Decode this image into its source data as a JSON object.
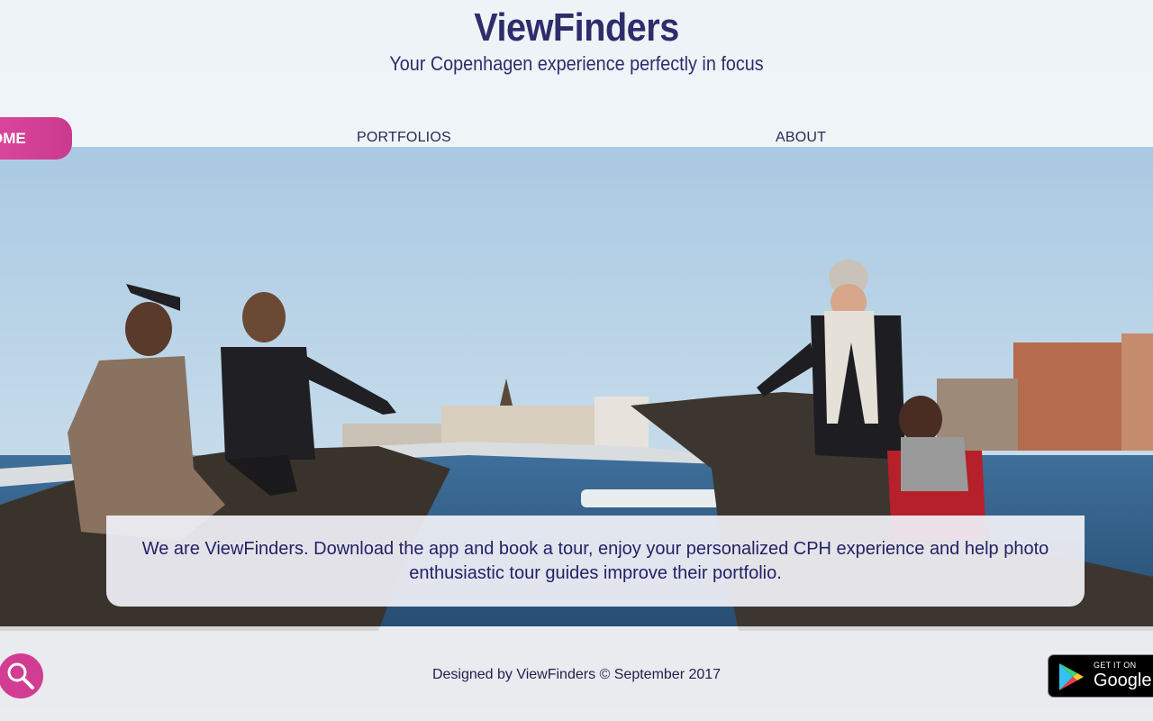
{
  "header": {
    "title": "ViewFinders",
    "tagline": "Your Copenhagen experience perfectly in focus"
  },
  "nav": {
    "home": "OME",
    "portfolios": "PORTFOLIOS",
    "about": "ABOUT"
  },
  "about": {
    "text": "We are ViewFinders. Download the app and book a tour, enjoy your personalized CPH experience and help photo enthusiastic tour guides improve their portfolio."
  },
  "footer": {
    "credit": "Designed by ViewFinders © September 2017"
  },
  "store_badge": {
    "small": "GET IT ON",
    "big": "Google"
  },
  "icons": {
    "search": "search-icon",
    "play": "google-play-icon"
  },
  "colors": {
    "brand": "#2e2d6b",
    "accent": "#d23c92"
  }
}
